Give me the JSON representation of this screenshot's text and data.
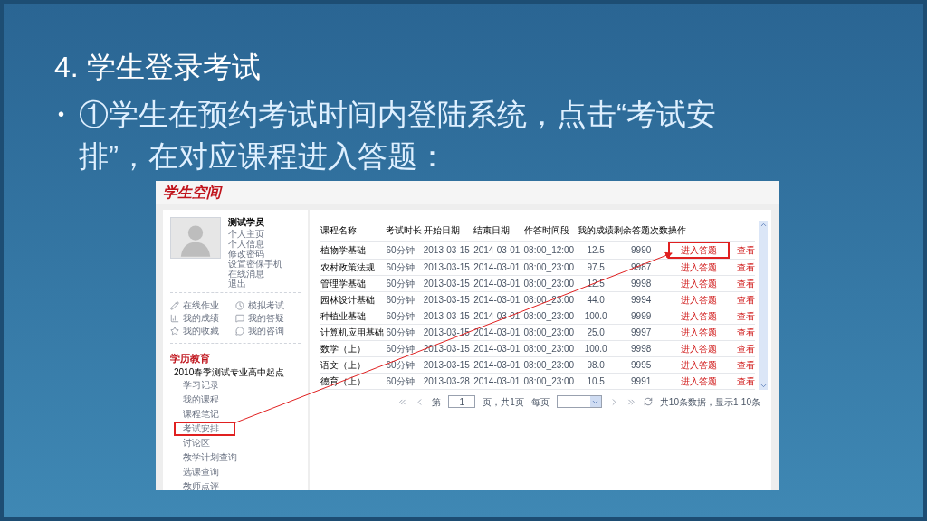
{
  "slide": {
    "title": "4. 学生登录考试",
    "bullet_mark": "•",
    "bullet": "①学生在预约考试时间内登陆系统，点击“考试安排”，在对应课程进入答题："
  },
  "screenshot": {
    "logo": "学生空间",
    "profile": {
      "name": "测试学员",
      "links": [
        "个人主页",
        "个人信息",
        "修改密码",
        "设置密保手机",
        "在线消息",
        "退出"
      ]
    },
    "quick_links": [
      {
        "kind": "pencil",
        "label": "在线作业"
      },
      {
        "kind": "clock",
        "label": "模拟考试"
      },
      {
        "kind": "chart",
        "label": "我的成绩"
      },
      {
        "kind": "message",
        "label": "我的答疑"
      },
      {
        "kind": "star",
        "label": "我的收藏"
      },
      {
        "kind": "chat",
        "label": "我的咨询"
      }
    ],
    "section": "学历教育",
    "program": "2010春季测试专业高中起点",
    "nav": [
      {
        "label": "学习记录",
        "selected": false
      },
      {
        "label": "我的课程",
        "selected": false
      },
      {
        "label": "课程笔记",
        "selected": false
      },
      {
        "label": "考试安排",
        "selected": true
      },
      {
        "label": "讨论区",
        "selected": false
      },
      {
        "label": "教学计划查询",
        "selected": false
      },
      {
        "label": "选课查询",
        "selected": false
      },
      {
        "label": "教师点评",
        "selected": false
      }
    ],
    "table": {
      "columns": [
        "课程名称",
        "考试时长",
        "开始日期",
        "结束日期",
        "作答时间段",
        "我的成绩",
        "剩余答题次数",
        "操作"
      ],
      "rows": [
        {
          "cells": [
            "植物学基础",
            "60分钟",
            "2013-03-15",
            "2014-03-01",
            "08:00_12:00",
            "12.5",
            "9990"
          ],
          "actions": [
            "进入答题",
            "查看"
          ],
          "highlighted": true
        },
        {
          "cells": [
            "农村政策法规",
            "60分钟",
            "2013-03-15",
            "2014-03-01",
            "08:00_23:00",
            "97.5",
            "9987"
          ],
          "actions": [
            "进入答题",
            "查看"
          ],
          "highlighted": false
        },
        {
          "cells": [
            "管理学基础",
            "60分钟",
            "2013-03-15",
            "2014-03-01",
            "08:00_23:00",
            "12.5",
            "9998"
          ],
          "actions": [
            "进入答题",
            "查看"
          ],
          "highlighted": false
        },
        {
          "cells": [
            "园林设计基础",
            "60分钟",
            "2013-03-15",
            "2014-03-01",
            "08:00_23:00",
            "44.0",
            "9994"
          ],
          "actions": [
            "进入答题",
            "查看"
          ],
          "highlighted": false
        },
        {
          "cells": [
            "种植业基础",
            "60分钟",
            "2013-03-15",
            "2014-03-01",
            "08:00_23:00",
            "100.0",
            "9999"
          ],
          "actions": [
            "进入答题",
            "查看"
          ],
          "highlighted": false
        },
        {
          "cells": [
            "计算机应用基础",
            "60分钟",
            "2013-03-15",
            "2014-03-01",
            "08:00_23:00",
            "25.0",
            "9997"
          ],
          "actions": [
            "进入答题",
            "查看"
          ],
          "highlighted": false
        },
        {
          "cells": [
            "数学（上）",
            "60分钟",
            "2013-03-15",
            "2014-03-01",
            "08:00_23:00",
            "100.0",
            "9998"
          ],
          "actions": [
            "进入答题",
            "查看"
          ],
          "highlighted": false
        },
        {
          "cells": [
            "语文（上）",
            "60分钟",
            "2013-03-15",
            "2014-03-01",
            "08:00_23:00",
            "98.0",
            "9995"
          ],
          "actions": [
            "进入答题",
            "查看"
          ],
          "highlighted": false
        },
        {
          "cells": [
            "德育（上）",
            "60分钟",
            "2013-03-28",
            "2014-03-01",
            "08:00_23:00",
            "10.5",
            "9991"
          ],
          "actions": [
            "进入答题",
            "查看"
          ],
          "highlighted": false
        }
      ]
    },
    "pagination": {
      "page_prefix": "第",
      "page": "1",
      "page_suffix": "页，共1页",
      "per_page": "每页",
      "summary": "共10条数据，显示1-10条"
    }
  }
}
